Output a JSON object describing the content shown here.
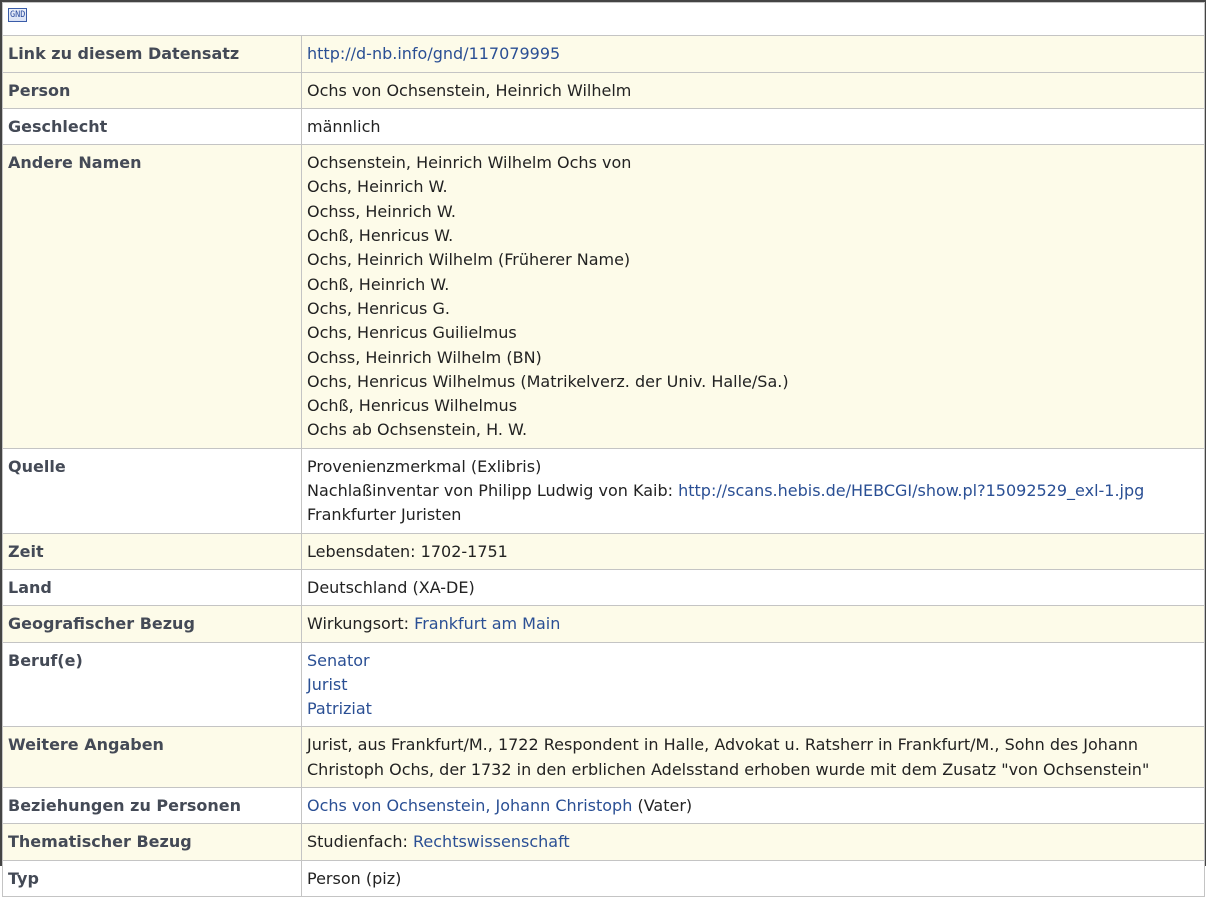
{
  "header": {
    "gnd_icon_label": "GND"
  },
  "rows": {
    "link": {
      "label": "Link zu diesem Datensatz",
      "url": "http://d-nb.info/gnd/117079995"
    },
    "person": {
      "label": "Person",
      "value": "Ochs von Ochsenstein, Heinrich Wilhelm"
    },
    "gender": {
      "label": "Geschlecht",
      "value": "männlich"
    },
    "other_names": {
      "label": "Andere Namen",
      "items": [
        "Ochsenstein, Heinrich Wilhelm Ochs von",
        "Ochs, Heinrich W.",
        "Ochss, Heinrich W.",
        "Ochß, Henricus W.",
        "Ochs, Heinrich Wilhelm (Früherer Name)",
        "Ochß, Heinrich W.",
        "Ochs, Henricus G.",
        "Ochs, Henricus Guilielmus",
        "Ochss, Heinrich Wilhelm (BN)",
        "Ochs, Henricus Wilhelmus (Matrikelverz. der Univ. Halle/Sa.)",
        "Ochß, Henricus Wilhelmus",
        "Ochs ab Ochsenstein, H. W."
      ]
    },
    "source": {
      "label": "Quelle",
      "line1": "Provenienzmerkmal (Exlibris)",
      "line2_text": "Nachlaßinventar von Philipp Ludwig von Kaib: ",
      "line2_link": "http://scans.hebis.de/HEBCGI/show.pl?15092529_exl-1.jpg",
      "line3": "Frankfurter Juristen"
    },
    "time": {
      "label": "Zeit",
      "value": "Lebensdaten: 1702-1751"
    },
    "country": {
      "label": "Land",
      "value": "Deutschland (XA-DE)"
    },
    "geo": {
      "label": "Geografischer Bezug",
      "prefix": "Wirkungsort: ",
      "link": "Frankfurt am Main"
    },
    "professions": {
      "label": "Beruf(e)",
      "items": [
        "Senator",
        "Jurist",
        "Patriziat"
      ]
    },
    "further": {
      "label": "Weitere Angaben",
      "line1": "Jurist, aus Frankfurt/M., 1722 Respondent in Halle, Advokat u. Ratsherr in Frankfurt/M., Sohn des Johann",
      "line2": "Christoph Ochs, der 1732 in den erblichen Adelsstand erhoben wurde mit dem Zusatz \"von Ochsenstein\""
    },
    "relations": {
      "label": "Beziehungen zu Personen",
      "link": "Ochs von Ochsenstein, Johann Christoph",
      "suffix": " (Vater)"
    },
    "topic": {
      "label": "Thematischer Bezug",
      "prefix": "Studienfach: ",
      "link": "Rechtswissenschaft"
    },
    "type": {
      "label": "Typ",
      "value": "Person (piz)"
    }
  }
}
